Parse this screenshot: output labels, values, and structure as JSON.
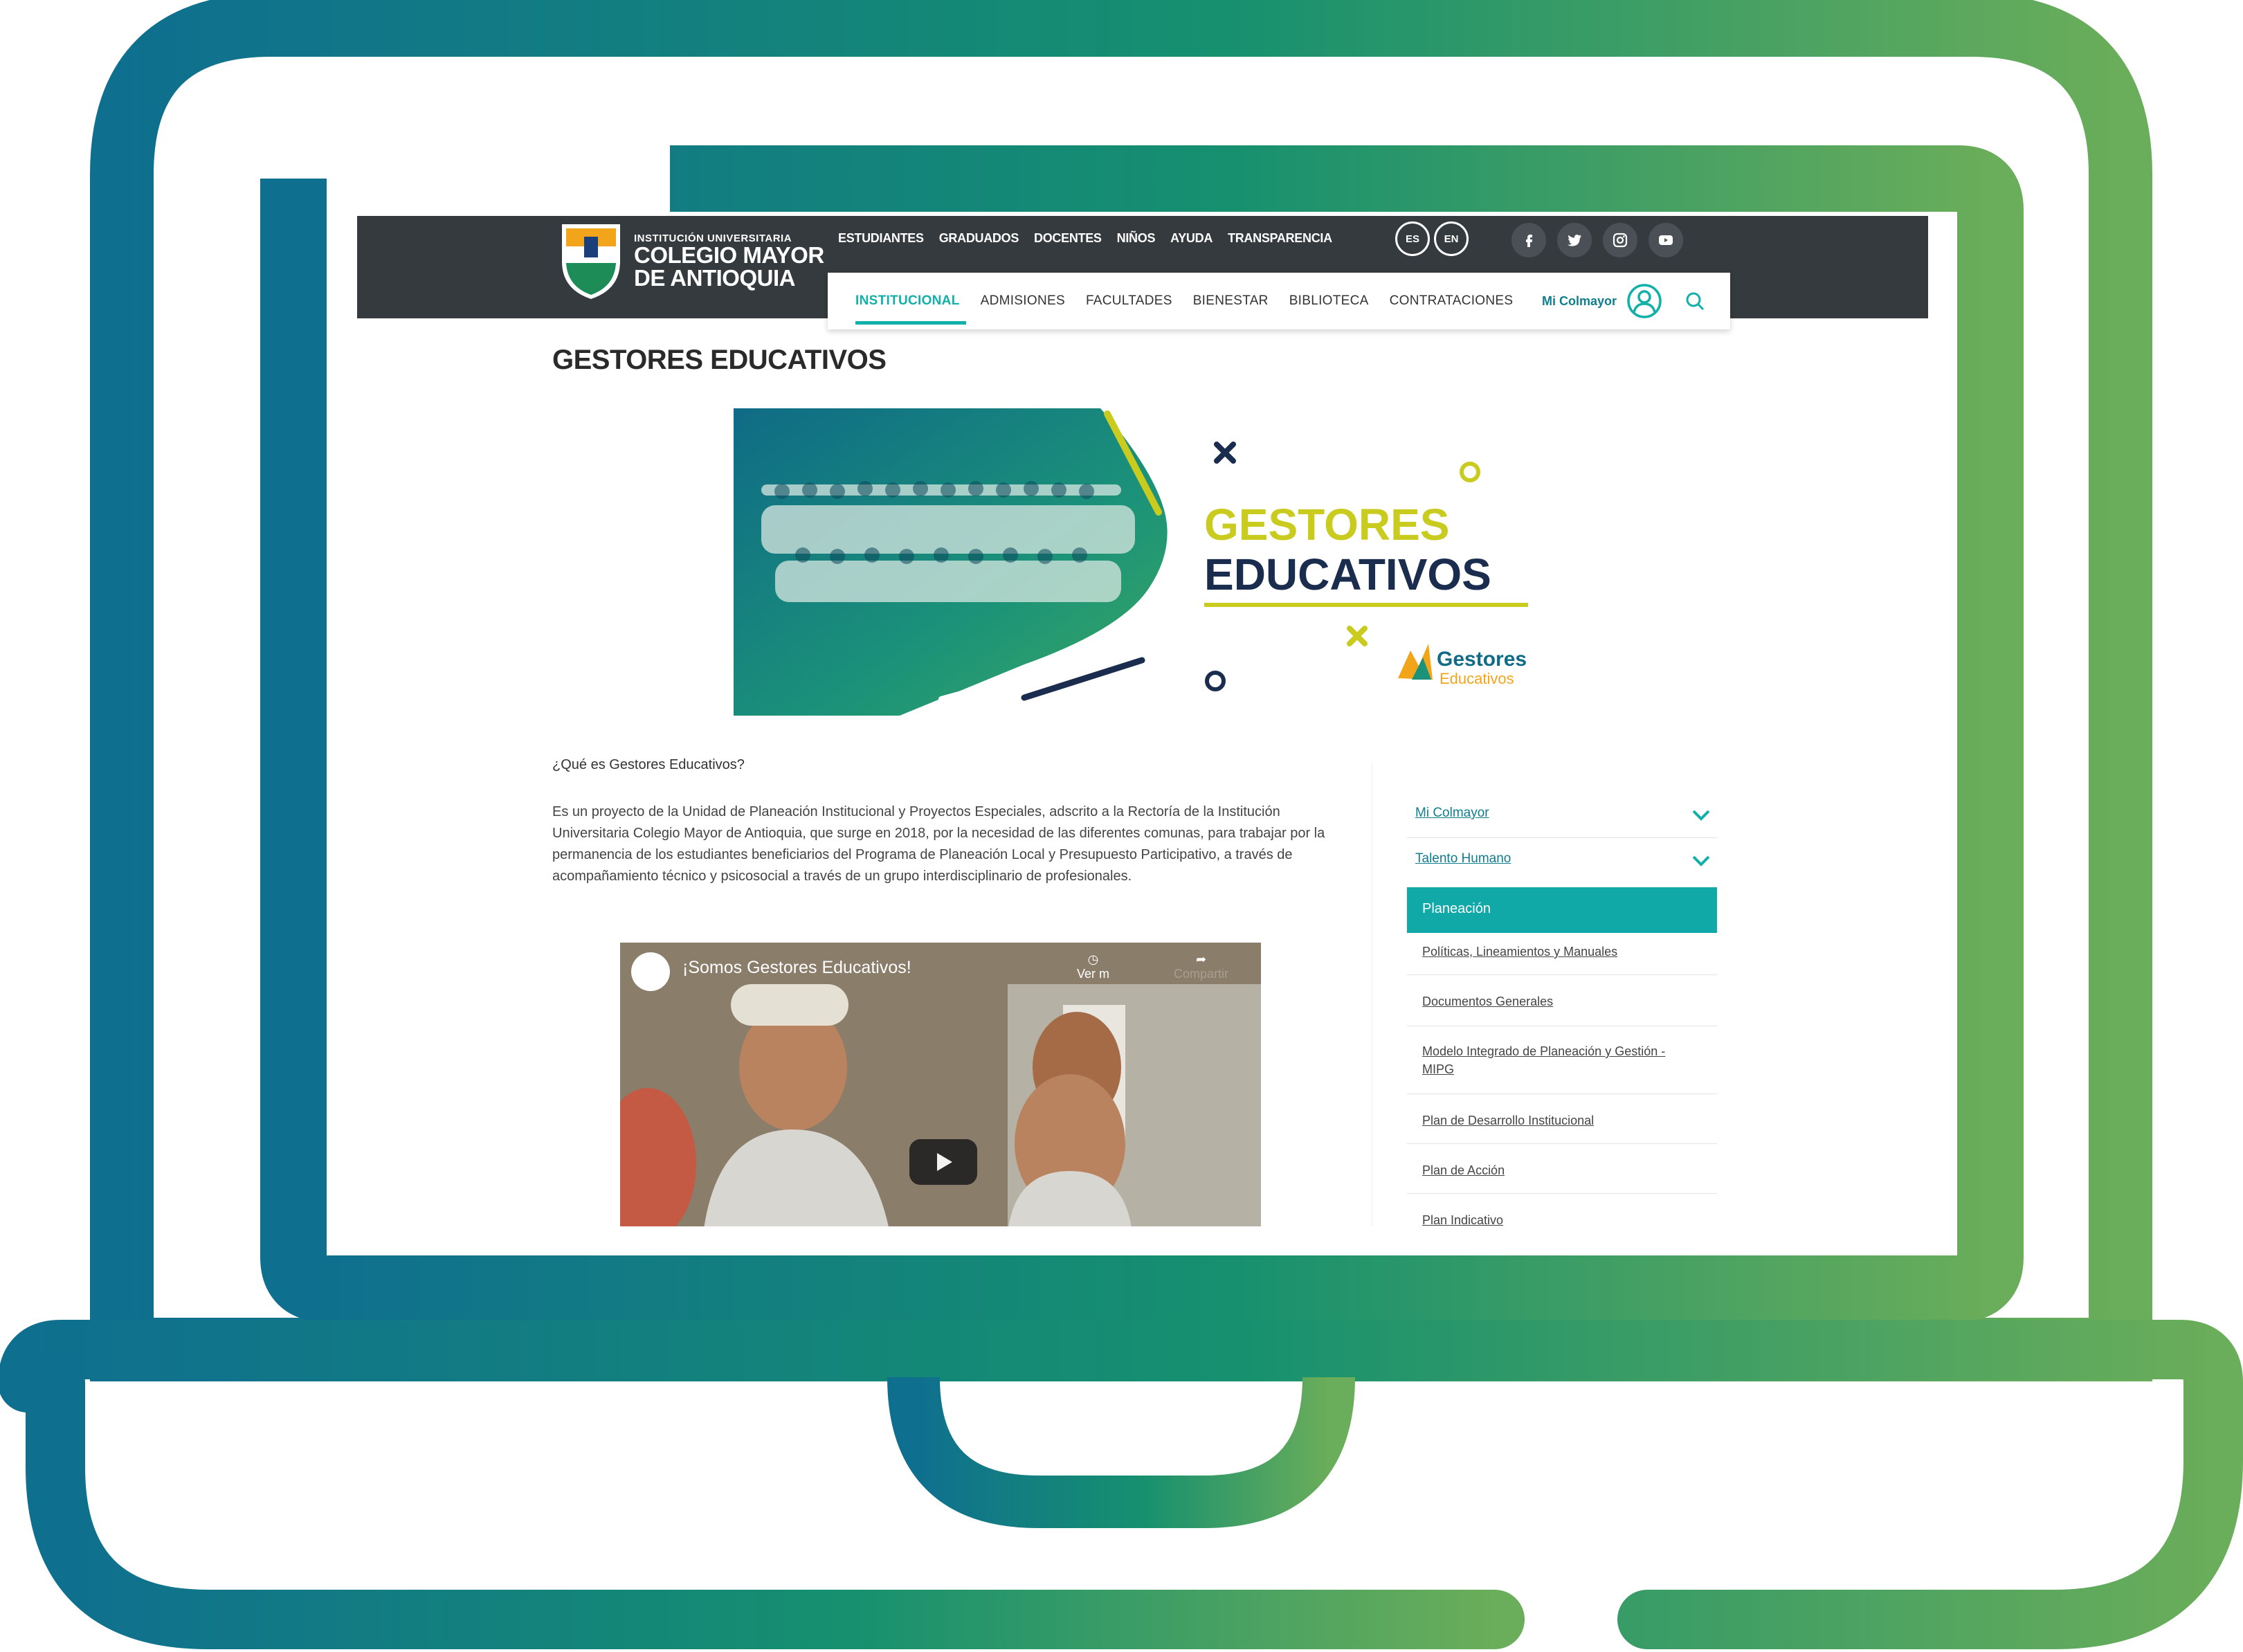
{
  "colors": {
    "gradient_start": "#0f6f8f",
    "gradient_end": "#6aad5a",
    "topbar": "#353a3e",
    "accent": "#11b0a8",
    "link": "#0f7d8c",
    "banner_yellow": "#c9cc1e",
    "banner_navy": "#1b2d4e"
  },
  "header": {
    "logo_line1": "INSTITUCIÓN UNIVERSITARIA",
    "logo_line2": "COLEGIO MAYOR",
    "logo_line3": "DE ANTIOQUIA",
    "top_nav": [
      "ESTUDIANTES",
      "GRADUADOS",
      "DOCENTES",
      "NIÑOS",
      "AYUDA",
      "TRANSPARENCIA"
    ],
    "languages": [
      "ES",
      "EN"
    ],
    "social_icons": [
      "facebook-icon",
      "twitter-icon",
      "instagram-icon",
      "youtube-icon"
    ],
    "main_nav": [
      "INSTITUCIONAL",
      "ADMISIONES",
      "FACULTADES",
      "BIENESTAR",
      "BIBLIOTECA",
      "CONTRATACIONES"
    ],
    "active_nav": "INSTITUCIONAL",
    "account_label": "Mi Colmayor"
  },
  "page": {
    "title": "GESTORES EDUCATIVOS",
    "banner": {
      "title_line1": "GESTORES",
      "title_line2": "EDUCATIVOS",
      "logo_line1": "Gestores",
      "logo_line2": "Educativos"
    },
    "question": "¿Qué es Gestores Educativos?",
    "paragraph": "Es un proyecto de la Unidad de Planeación Institucional y Proyectos Especiales, adscrito a la Rectoría de la Institución Universitaria Colegio Mayor de Antioquia, que surge en 2018, por la necesidad de las diferentes comunas, para trabajar por la permanencia de los estudiantes beneficiarios del Programa de Planeación Local y Presupuesto Participativo, a través de acompañamiento técnico y psicosocial a través de un grupo interdisciplinario de profesionales.",
    "video": {
      "title": "¡Somos Gestores Educativos!",
      "watch_later": "Ver m",
      "share": "Compartir"
    }
  },
  "sidebar": {
    "sections": [
      {
        "label": "Mi Colmayor"
      },
      {
        "label": "Talento Humano"
      }
    ],
    "active": "Planeación",
    "sub_items": [
      "Políticas, Lineamientos y Manuales",
      "Documentos Generales",
      "Modelo Integrado de Planeación y Gestión - MIPG",
      "Plan de Desarrollo Institucional",
      "Plan de Acción",
      "Plan Indicativo"
    ]
  }
}
